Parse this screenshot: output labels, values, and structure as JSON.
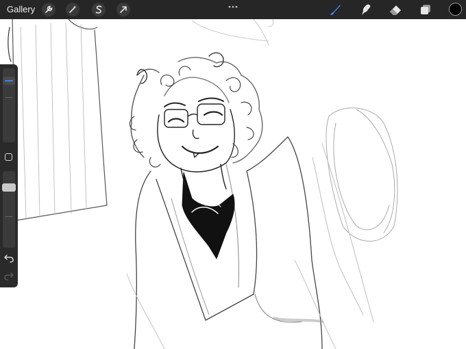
{
  "toolbar": {
    "gallery_label": "Gallery",
    "left_tools": [
      "wrench-icon",
      "magic-wand-icon",
      "selection-s-icon",
      "transform-arrow-icon"
    ],
    "right_tools": [
      "brush-icon",
      "smudge-icon",
      "eraser-icon",
      "layers-icon"
    ],
    "active_tool": "brush-icon",
    "active_color": "#000000",
    "accent": "#3c82f6"
  },
  "sidebar": {
    "brush_size_level": 0.12,
    "opacity_level": 0.18,
    "undo_icon": "undo-icon",
    "redo_icon": "redo-icon"
  }
}
